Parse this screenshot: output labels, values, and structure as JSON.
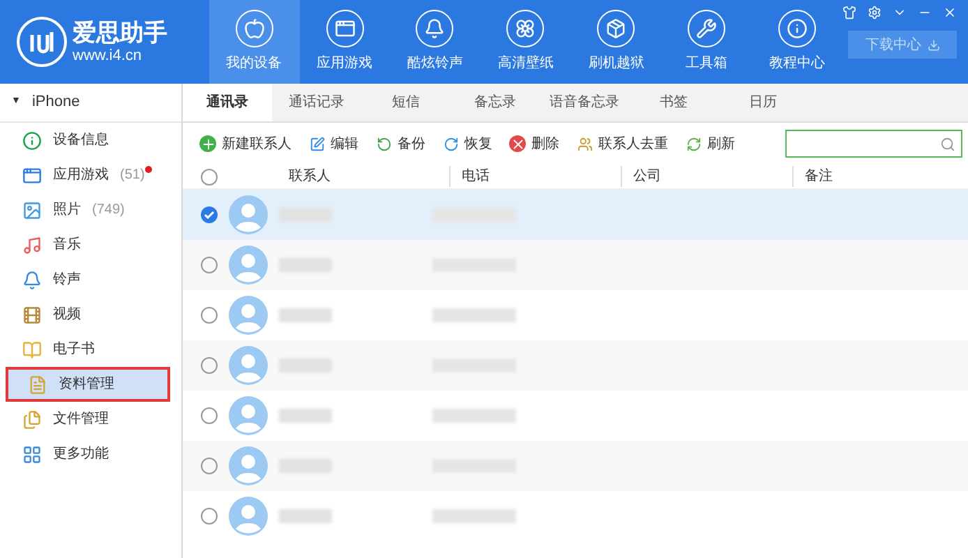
{
  "app": {
    "name": "爱思助手",
    "url": "www.i4.cn"
  },
  "nav": [
    {
      "label": "我的设备",
      "selected": true
    },
    {
      "label": "应用游戏",
      "selected": false
    },
    {
      "label": "酷炫铃声",
      "selected": false
    },
    {
      "label": "高清壁纸",
      "selected": false
    },
    {
      "label": "刷机越狱",
      "selected": false
    },
    {
      "label": "工具箱",
      "selected": false
    },
    {
      "label": "教程中心",
      "selected": false
    }
  ],
  "download_button": "下载中心",
  "sidebar": {
    "caret": "▼",
    "device": "iPhone",
    "items": [
      {
        "label": "设备信息",
        "selected": false,
        "highlighted": false
      },
      {
        "label": "应用游戏",
        "count": "(51)",
        "badge": true,
        "selected": false,
        "highlighted": false
      },
      {
        "label": "照片",
        "count": "(749)",
        "selected": false,
        "highlighted": false
      },
      {
        "label": "音乐",
        "selected": false,
        "highlighted": false
      },
      {
        "label": "铃声",
        "selected": false,
        "highlighted": false
      },
      {
        "label": "视频",
        "selected": false,
        "highlighted": false
      },
      {
        "label": "电子书",
        "selected": false,
        "highlighted": false
      },
      {
        "label": "资料管理",
        "selected": true,
        "highlighted": true
      },
      {
        "label": "文件管理",
        "selected": false,
        "highlighted": false
      },
      {
        "label": "更多功能",
        "selected": false,
        "highlighted": false
      }
    ]
  },
  "tabs": [
    {
      "label": "通讯录",
      "selected": true
    },
    {
      "label": "通话记录",
      "selected": false
    },
    {
      "label": "短信",
      "selected": false
    },
    {
      "label": "备忘录",
      "selected": false
    },
    {
      "label": "语音备忘录",
      "selected": false
    },
    {
      "label": "书签",
      "selected": false
    },
    {
      "label": "日历",
      "selected": false
    }
  ],
  "toolbar": [
    {
      "label": "新建联系人"
    },
    {
      "label": "编辑"
    },
    {
      "label": "备份"
    },
    {
      "label": "恢复"
    },
    {
      "label": "删除"
    },
    {
      "label": "联系人去重"
    },
    {
      "label": "刷新"
    }
  ],
  "table": {
    "all_selected": false,
    "columns": [
      "联系人",
      "电话",
      "公司",
      "备注"
    ],
    "rows": [
      {
        "selected": true
      },
      {
        "selected": false
      },
      {
        "selected": false
      },
      {
        "selected": false
      },
      {
        "selected": false
      },
      {
        "selected": false
      },
      {
        "selected": false
      }
    ]
  }
}
